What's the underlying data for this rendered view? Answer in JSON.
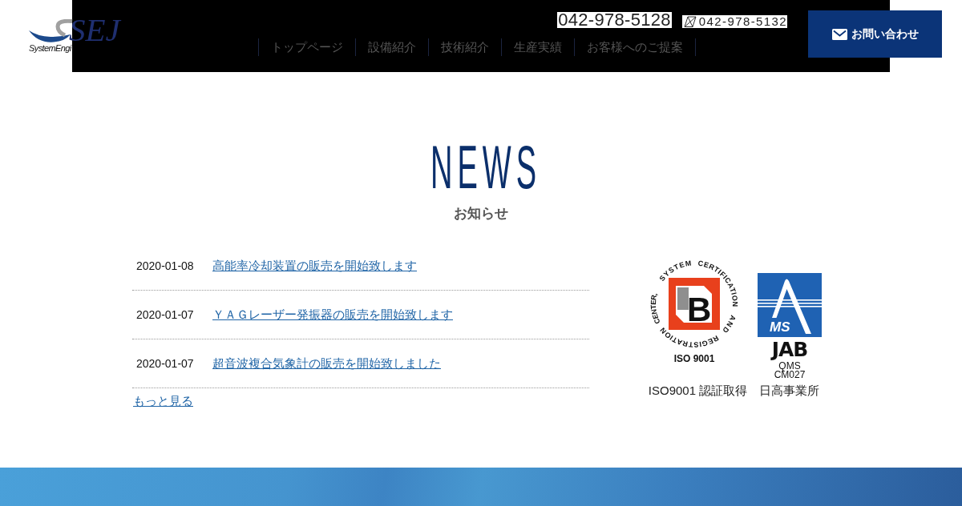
{
  "header": {
    "logo": {
      "mark": "SEJ",
      "tagline": "SystemEngi"
    },
    "phone": "042-978-5128",
    "fax": "042-978-5132",
    "contact_button": "お問い合わせ",
    "nav": [
      "トップページ",
      "設備紹介",
      "技術紹介",
      "生産実績",
      "お客様へのご提案"
    ]
  },
  "news": {
    "title": "NEWS",
    "subtitle": "お知らせ",
    "items": [
      {
        "date": "2020-01-08",
        "title": "高能率冷却装置の販売を開始致します"
      },
      {
        "date": "2020-01-07",
        "title": "ＹＡＧレーザー発振器の販売を開始致します"
      },
      {
        "date": "2020-01-07",
        "title": "超音波複合気象計の販売を開始致しました"
      }
    ],
    "more_link": "もっと見る"
  },
  "certification": {
    "iso_mark": {
      "ring_words": [
        "SYSTEM",
        "CERTIFICATION",
        "AND",
        "REGISTRATION",
        "CENTER,"
      ],
      "letter": "B",
      "standard": "ISO 9001"
    },
    "jab_mark": {
      "emblem_text": "MS",
      "name": "JAB",
      "lines": [
        "QMS",
        "CM027"
      ]
    },
    "caption": "ISO9001 認証取得　日高事業所"
  }
}
